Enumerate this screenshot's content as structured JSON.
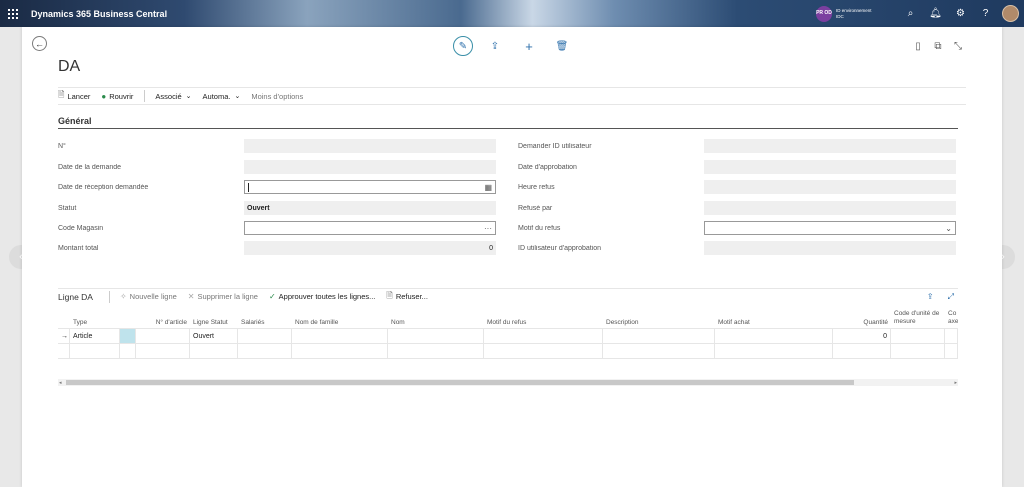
{
  "app": {
    "name": "Dynamics 365 Business Central",
    "env_badge": "PR OD",
    "env_line1": "ID environnement",
    "env_line2": "IDC"
  },
  "page": {
    "title": "DA"
  },
  "actions": {
    "release": "Lancer",
    "reopen": "Rouvrir",
    "related": "Associé",
    "automate": "Automa.",
    "fewer": "Moins d'options"
  },
  "section": {
    "title": "Général"
  },
  "left_fields": [
    {
      "label": "N°",
      "value": ""
    },
    {
      "label": "Date de la demande",
      "value": ""
    },
    {
      "label": "Date de réception demandée",
      "value": ""
    },
    {
      "label": "Statut",
      "value": "Ouvert"
    },
    {
      "label": "Code Magasin",
      "value": ""
    },
    {
      "label": "Montant total",
      "value": "0"
    }
  ],
  "right_fields": [
    {
      "label": "Demander ID utilisateur",
      "value": ""
    },
    {
      "label": "Date d'approbation",
      "value": ""
    },
    {
      "label": "Heure refus",
      "value": ""
    },
    {
      "label": "Refusé par",
      "value": ""
    },
    {
      "label": "Motif du refus",
      "value": ""
    },
    {
      "label": "ID utilisateur d'approbation",
      "value": ""
    }
  ],
  "lines": {
    "title": "Ligne DA",
    "new_line": "Nouvelle ligne",
    "delete_line": "Supprimer la ligne",
    "approve_all": "Approuver toutes les lignes...",
    "refuse": "Refuser...",
    "columns": [
      "Type",
      "N° d'article",
      "Ligne Statut",
      "Salariés",
      "Nom de famille",
      "Nom",
      "Motif du refus",
      "Description",
      "Motif achat",
      "Quantité",
      "Code d'unité de mesure",
      "Co axe"
    ],
    "rows": [
      {
        "type": "Article",
        "item_no": "",
        "status": "Ouvert",
        "quantity": "0"
      }
    ]
  },
  "icons": {
    "waffle": "app-launcher-icon",
    "search": "search-icon",
    "bell": "bell-icon",
    "gear": "gear-icon",
    "help": "help-icon"
  }
}
